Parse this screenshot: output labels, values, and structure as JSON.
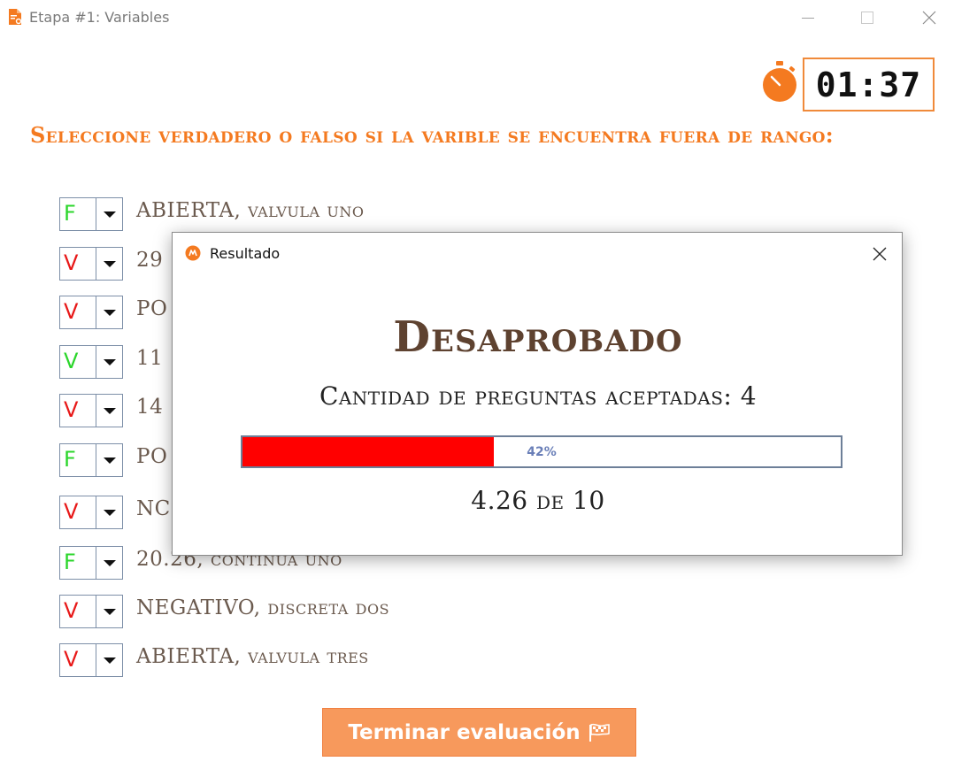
{
  "window": {
    "title": "Etapa #1: Variables",
    "icons": {
      "app": "document-icon",
      "minimize": "minimize-icon",
      "maximize": "maximize-icon",
      "close": "close-icon"
    }
  },
  "timer": {
    "value": "01:37",
    "icon": "stopwatch-icon",
    "accent_color": "#f47a20"
  },
  "instruction": "Seleccione verdadero o falso si la varible se encuentra fuera de rango:",
  "questions": [
    {
      "value": "F",
      "value_color": "#2bd62b",
      "text": "ABIERTA, valvula uno"
    },
    {
      "value": "V",
      "value_color": "#e81818",
      "text": "29"
    },
    {
      "value": "V",
      "value_color": "#e81818",
      "text": "PO"
    },
    {
      "value": "V",
      "value_color": "#2bd62b",
      "text": "11"
    },
    {
      "value": "V",
      "value_color": "#e81818",
      "text": "14"
    },
    {
      "value": "F",
      "value_color": "#2bd62b",
      "text": "PO"
    },
    {
      "value": "V",
      "value_color": "#e81818",
      "text": "NC"
    },
    {
      "value": "F",
      "value_color": "#2bd62b",
      "text": "20.26, continua uno"
    },
    {
      "value": "V",
      "value_color": "#e81818",
      "text": "NEGATIVO, discreta dos"
    },
    {
      "value": "V",
      "value_color": "#e81818",
      "text": "ABIERTA, valvula tres"
    }
  ],
  "finish_button": {
    "label": "Terminar evaluación",
    "icon": "checkered-flag-icon",
    "color": "#f7995c"
  },
  "dialog": {
    "title": "Resultado",
    "icon": "app-logo-icon",
    "result": "Desaprobado",
    "result_color": "#5e4230",
    "count_text": "Cantidad de preguntas aceptadas: 4",
    "progress": {
      "percent": 42,
      "label": "42%",
      "fill_color": "#ff0000"
    },
    "score_text": "4.26 de 10"
  }
}
